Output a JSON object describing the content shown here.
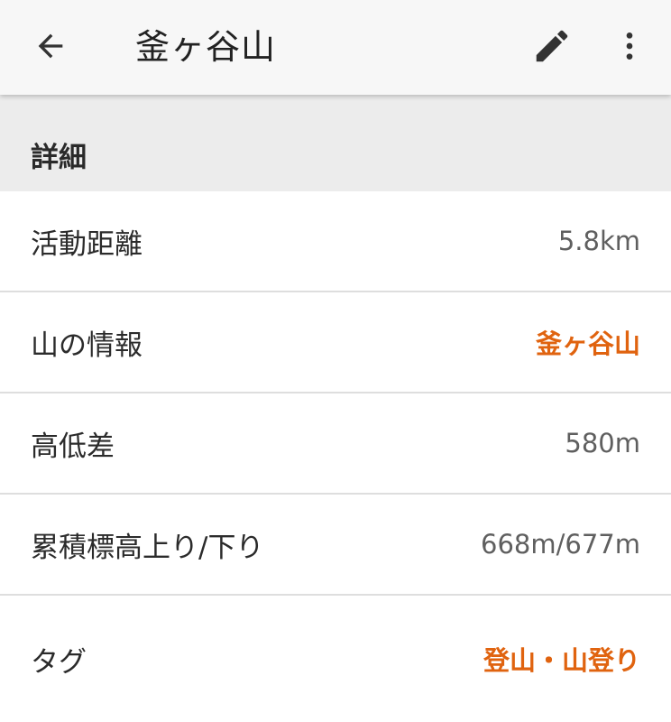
{
  "appbar": {
    "title": "釜ヶ谷山",
    "back_icon": "arrow-back-icon",
    "edit_icon": "pencil-icon",
    "more_icon": "more-vert-icon"
  },
  "section": {
    "header": "詳細"
  },
  "details": {
    "rows": [
      {
        "label": "活動距離",
        "value": "5.8km"
      },
      {
        "label": "山の情報",
        "value": "釜ヶ谷山"
      },
      {
        "label": "高低差",
        "value": "580m"
      },
      {
        "label": "累積標高上り/下り",
        "value": "668m/677m"
      },
      {
        "label": "タグ",
        "value": "登山・山登り"
      }
    ]
  },
  "colors": {
    "accent": "#e0630f",
    "appbar_bg": "#f7f7f7",
    "section_bg": "#ececec",
    "divider": "#dedede"
  }
}
